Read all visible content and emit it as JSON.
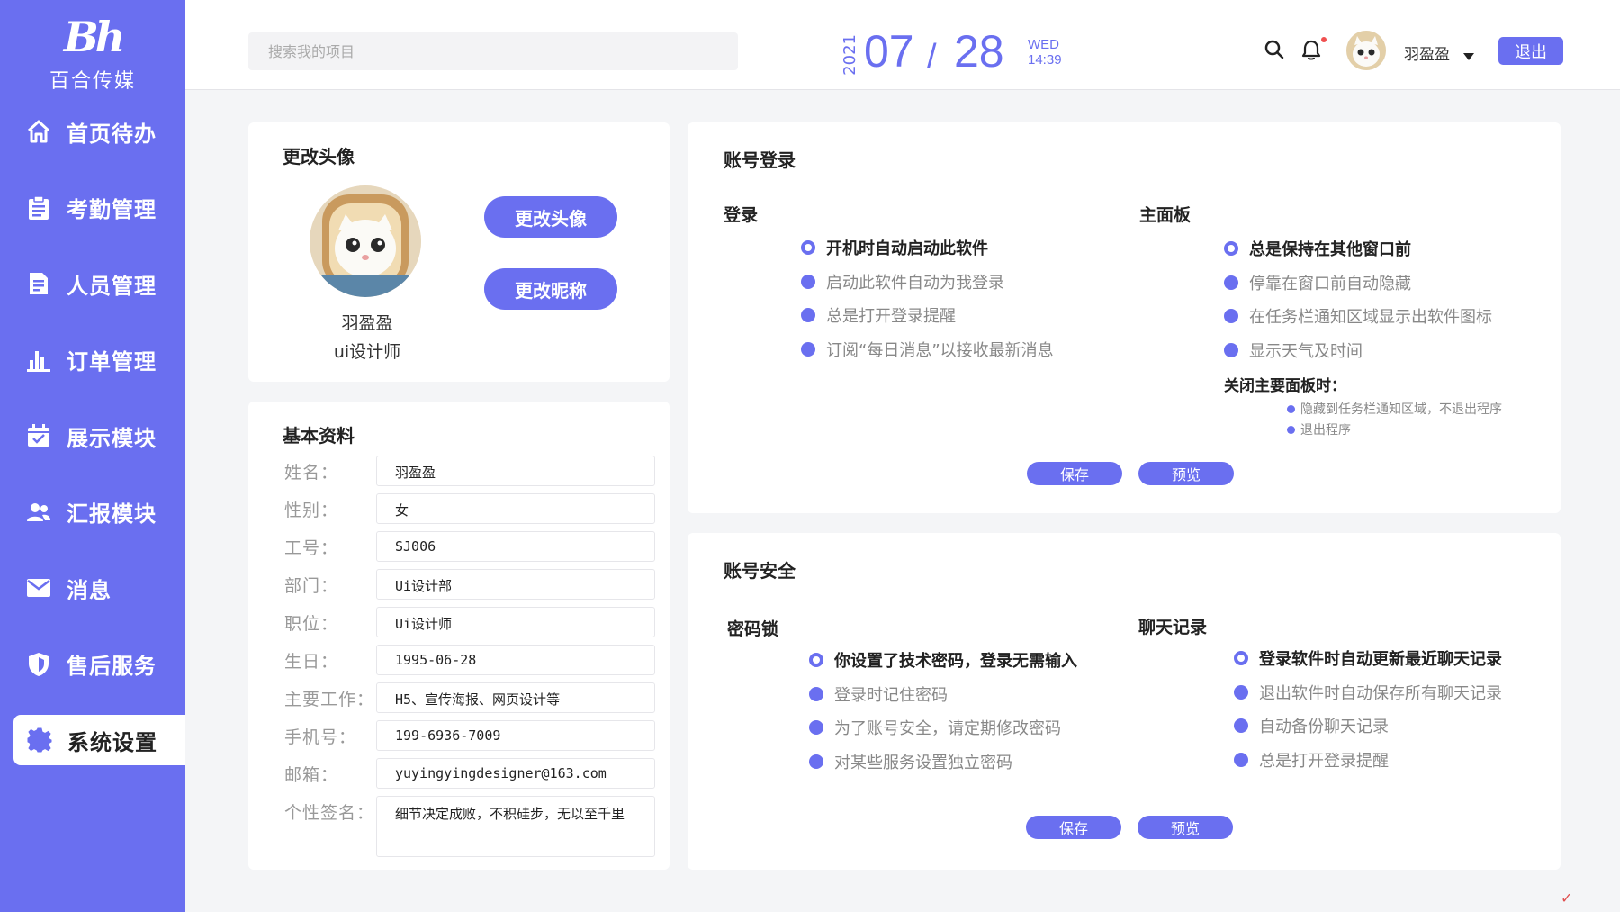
{
  "brand": {
    "mark": "Bh",
    "name": "百合传媒"
  },
  "nav": [
    {
      "label": "首页待办",
      "icon": "home-icon"
    },
    {
      "label": "考勤管理",
      "icon": "clipboard-icon"
    },
    {
      "label": "人员管理",
      "icon": "document-icon"
    },
    {
      "label": "订单管理",
      "icon": "bar-chart-icon"
    },
    {
      "label": "展示模块",
      "icon": "calendar-check-icon"
    },
    {
      "label": "汇报模块",
      "icon": "users-icon"
    },
    {
      "label": "消息",
      "icon": "mail-icon"
    },
    {
      "label": "售后服务",
      "icon": "shield-icon"
    },
    {
      "label": "系统设置",
      "icon": "gear-icon",
      "active": true
    }
  ],
  "header": {
    "search_placeholder": "搜索我的项目",
    "date": {
      "year": "2021",
      "month": "07",
      "slash": "/",
      "day": "28",
      "weekday": "WED",
      "time": "14:39"
    },
    "username": "羽盈盈",
    "logout_label": "退出"
  },
  "avatar_card": {
    "title": "更改头像",
    "name": "羽盈盈",
    "role": "ui设计师",
    "change_avatar_label": "更改头像",
    "change_nickname_label": "更改昵称"
  },
  "basic_info": {
    "title": "基本资料",
    "fields": [
      {
        "label": "姓名：",
        "value": "羽盈盈"
      },
      {
        "label": "性别：",
        "value": "女"
      },
      {
        "label": "工号：",
        "value": "SJ006"
      },
      {
        "label": "部门：",
        "value": "Ui设计部"
      },
      {
        "label": "职位：",
        "value": "Ui设计师"
      },
      {
        "label": "生日：",
        "value": "1995-06-28"
      },
      {
        "label": "主要工作：",
        "value": "H5、宣传海报、网页设计等"
      },
      {
        "label": "手机号：",
        "value": "199-6936-7009"
      },
      {
        "label": "邮箱：",
        "value": "yuyingyingdesigner@163.com"
      },
      {
        "label": "个性签名：",
        "value": "细节决定成败，不积硅步，无以至千里"
      }
    ]
  },
  "account_login": {
    "title": "账号登录",
    "login": {
      "title": "登录",
      "options": [
        {
          "text": "开机时自动启动此软件",
          "checked": true
        },
        {
          "text": "启动此软件自动为我登录",
          "checked": false
        },
        {
          "text": "总是打开登录提醒",
          "checked": false
        },
        {
          "text": "订阅“每日消息”以接收最新消息",
          "checked": false
        }
      ]
    },
    "panel": {
      "title": "主面板",
      "options": [
        {
          "text": "总是保持在其他窗口前",
          "checked": true
        },
        {
          "text": "停靠在窗口前自动隐藏",
          "checked": false
        },
        {
          "text": "在任务栏通知区域显示出软件图标",
          "checked": false
        },
        {
          "text": "显示天气及时间",
          "checked": false
        }
      ],
      "close_title": "关闭主要面板时：",
      "close_options": [
        "隐藏到任务栏通知区域，不退出程序",
        "退出程序"
      ]
    },
    "save_label": "保存",
    "preview_label": "预览"
  },
  "account_security": {
    "title": "账号安全",
    "password": {
      "title": "密码锁",
      "options": [
        {
          "text": "你设置了技术密码，登录无需输入",
          "checked": true
        },
        {
          "text": "登录时记住密码",
          "checked": false
        },
        {
          "text": "为了账号安全，请定期修改密码",
          "checked": false
        },
        {
          "text": "对某些服务设置独立密码",
          "checked": false
        }
      ]
    },
    "chat": {
      "title": "聊天记录",
      "options": [
        {
          "text": "登录软件时自动更新最近聊天记录",
          "checked": true
        },
        {
          "text": "退出软件时自动保存所有聊天记录",
          "checked": false
        },
        {
          "text": "自动备份聊天记录",
          "checked": false
        },
        {
          "text": "总是打开登录提醒",
          "checked": false
        }
      ]
    },
    "save_label": "保存",
    "preview_label": "预览"
  },
  "colors": {
    "accent": "#6a6ff0",
    "sidebar": "#6a6ff0",
    "background": "#f4f5f7"
  }
}
